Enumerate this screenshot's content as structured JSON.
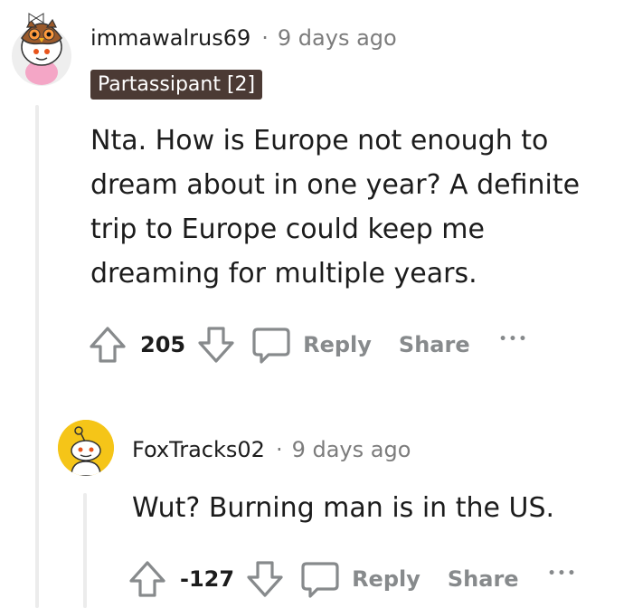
{
  "comments": [
    {
      "username": "immawalrus69",
      "separator": "·",
      "timestamp": "9 days ago",
      "flair": "Partassipant [2]",
      "body_lines": [
        "Nta. How is Europe not enough to",
        "dream about in one year? A definite",
        "trip to Europe could keep me",
        "dreaming for multiple years."
      ],
      "score": "205",
      "reply_label": "Reply",
      "share_label": "Share",
      "more_label": "•••",
      "avatar_icon": "owl-snoo-avatar-icon"
    },
    {
      "username": "FoxTracks02",
      "separator": "·",
      "timestamp": "9 days ago",
      "body_lines": [
        "Wut? Burning man is in the US."
      ],
      "score": "-127",
      "reply_label": "Reply",
      "share_label": "Share",
      "more_label": "•••",
      "avatar_icon": "default-snoo-avatar-icon"
    }
  ],
  "colors": {
    "flair_bg": "#4b3a34",
    "muted_text": "#878a8c",
    "thread_line": "#ececec",
    "avatar2_bg": "#f5c518"
  }
}
